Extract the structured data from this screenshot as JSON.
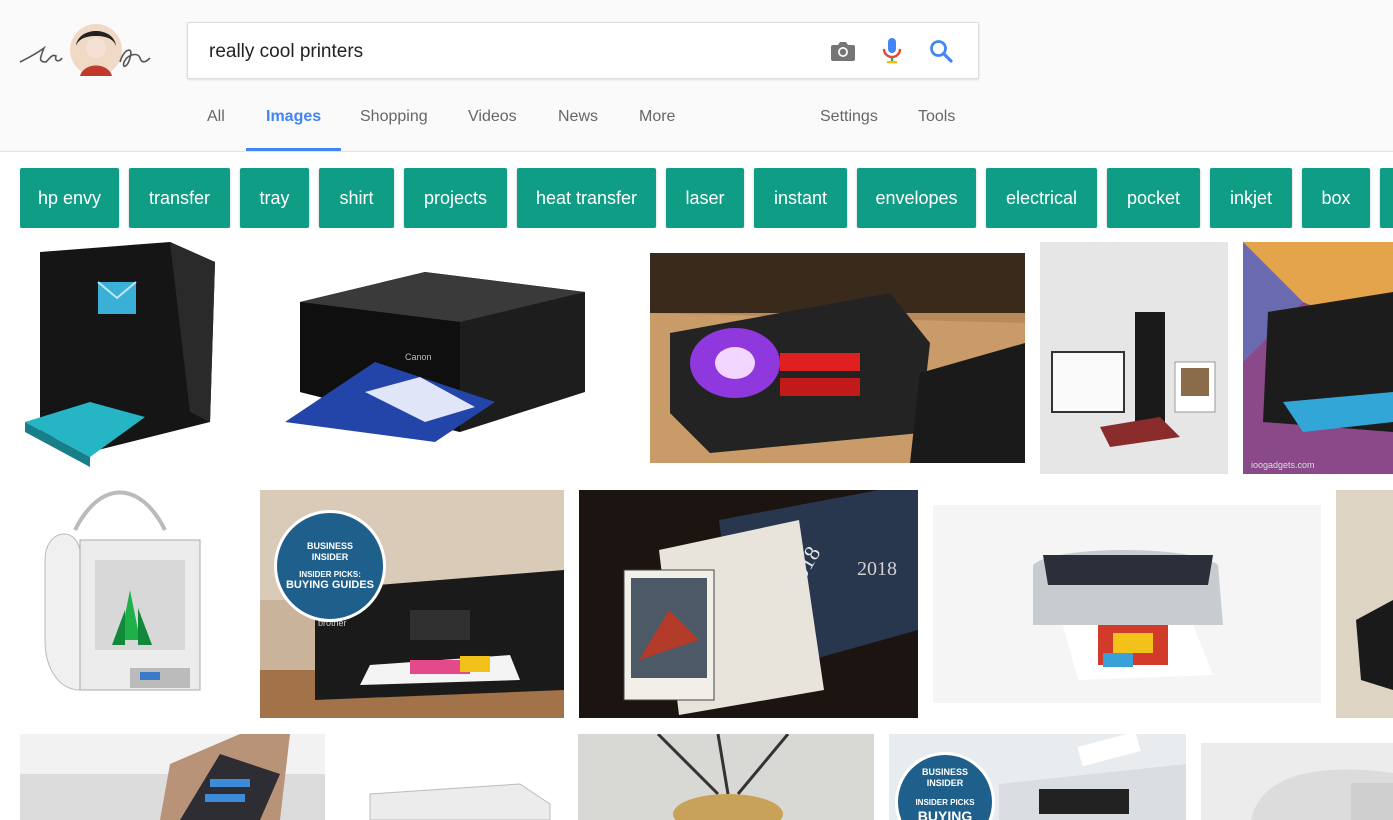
{
  "search": {
    "query": "really cool printers"
  },
  "tabs": [
    {
      "label": "All",
      "active": false
    },
    {
      "label": "Images",
      "active": true
    },
    {
      "label": "Shopping",
      "active": false
    },
    {
      "label": "Videos",
      "active": false
    },
    {
      "label": "News",
      "active": false
    },
    {
      "label": "More",
      "active": false
    }
  ],
  "tools": {
    "settings": "Settings",
    "tools": "Tools"
  },
  "chips": [
    "hp envy",
    "transfer",
    "tray",
    "shirt",
    "projects",
    "heat transfer",
    "laser",
    "instant",
    "envelopes",
    "electrical",
    "pocket",
    "inkjet",
    "box"
  ],
  "images": {
    "bi_badge": {
      "line1": "BUSINESS",
      "line2": "INSIDER",
      "line3": "INSIDER PICKS:",
      "line4": "BUYING GUIDES"
    },
    "bi_badge2": {
      "line1": "BUSINESS",
      "line2": "INSIDER",
      "line3": "INSIDER PICKS",
      "line4": "BUYING"
    },
    "canon_brand": "Canon",
    "brother_brand": "brother",
    "year1": "2018",
    "year2": "2018",
    "watermark": "ioogadgets.com"
  },
  "colors": {
    "accent": "#4285f4",
    "chip": "#0f9d86",
    "header_bg": "#fafafa"
  }
}
